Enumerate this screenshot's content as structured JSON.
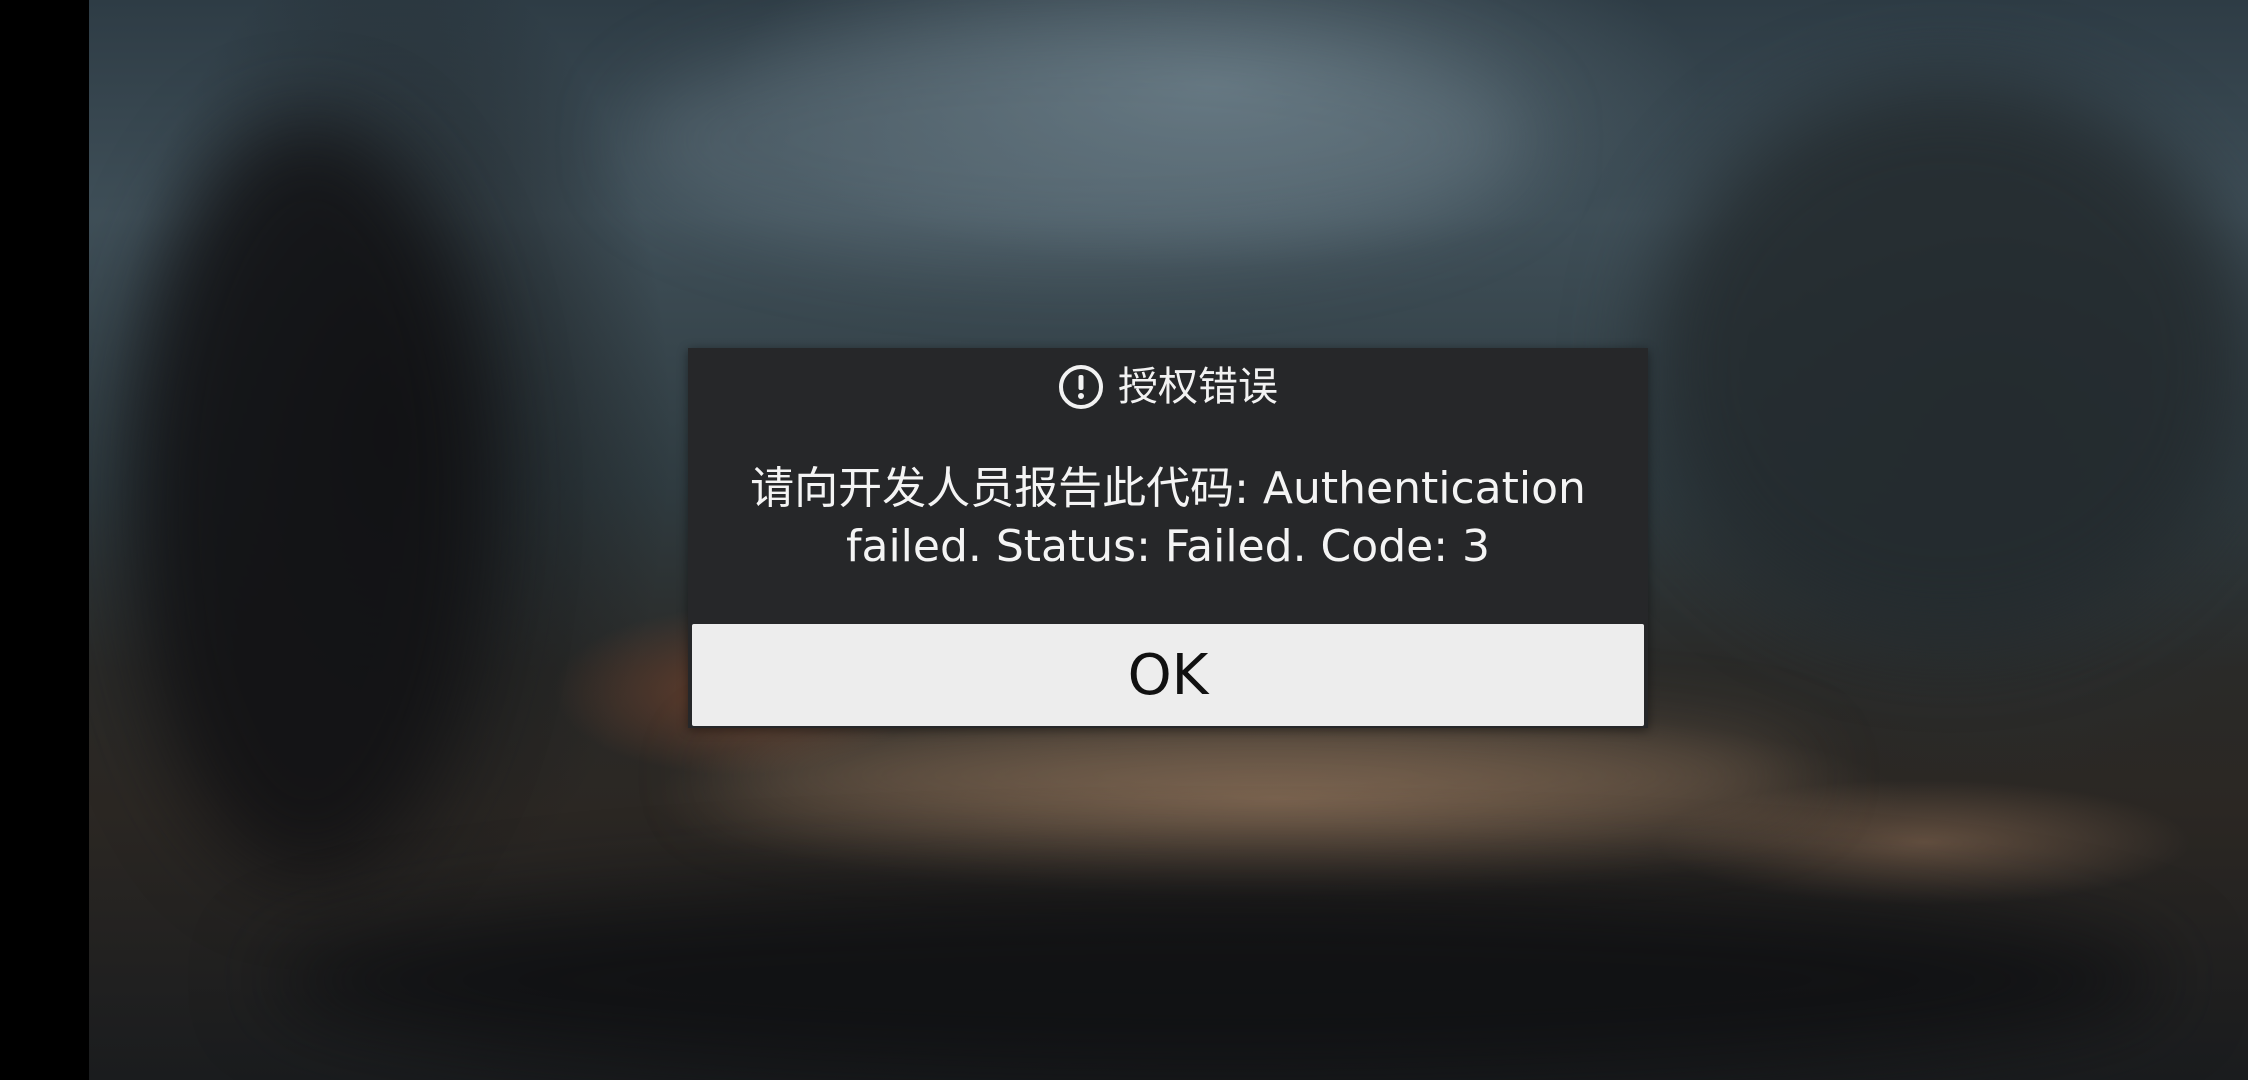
{
  "dialog": {
    "title": "授权错误",
    "icon": "alert-circle-icon",
    "message": "请向开发人员报告此代码: Authentication failed. Status: Failed. Code: 3",
    "ok_label": "OK"
  },
  "colors": {
    "dialog_bg": "#262729",
    "button_bg": "#ededed",
    "text_light": "#f4f4f4",
    "text_dark": "#111111"
  }
}
